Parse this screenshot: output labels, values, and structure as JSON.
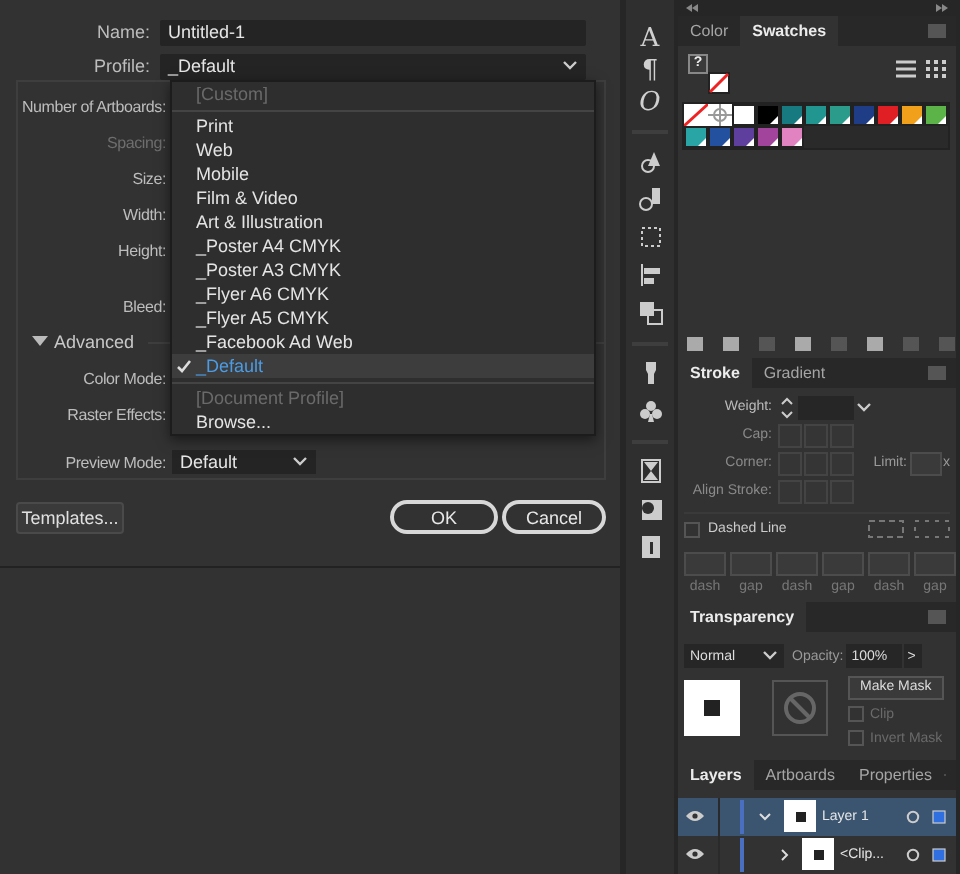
{
  "dialog": {
    "fields": [
      {
        "label": "Name:",
        "value": "Untitled-1"
      },
      {
        "label": "Profile:",
        "value": "_Default"
      }
    ],
    "settings": [
      {
        "label": "Number of Artboards:",
        "disabled": false
      },
      {
        "label": "Spacing:",
        "disabled": true
      },
      {
        "label": "Size:",
        "disabled": false
      },
      {
        "label": "Width:",
        "disabled": false
      },
      {
        "label": "Height:",
        "disabled": false
      },
      {
        "label": "Bleed:",
        "disabled": false
      }
    ],
    "advanced": {
      "label": "Advanced",
      "expanded": true
    },
    "advanced_settings": [
      {
        "label": "Color Mode:"
      },
      {
        "label": "Raster Effects:"
      },
      {
        "label": "Preview Mode:",
        "value": "Default"
      }
    ],
    "buttons": {
      "templates": "Templates...",
      "ok": "OK",
      "cancel": "Cancel"
    }
  },
  "profile_menu": {
    "items": [
      {
        "kind": "item",
        "label": "[Custom]",
        "disabled": true,
        "selected": false
      },
      {
        "kind": "separator"
      },
      {
        "kind": "item",
        "label": "Print",
        "disabled": false,
        "selected": false
      },
      {
        "kind": "item",
        "label": "Web",
        "disabled": false,
        "selected": false
      },
      {
        "kind": "item",
        "label": "Mobile",
        "disabled": false,
        "selected": false
      },
      {
        "kind": "item",
        "label": "Film & Video",
        "disabled": false,
        "selected": false
      },
      {
        "kind": "item",
        "label": "Art & Illustration",
        "disabled": false,
        "selected": false
      },
      {
        "kind": "item",
        "label": "_Poster A4 CMYK",
        "disabled": false,
        "selected": false
      },
      {
        "kind": "item",
        "label": "_Poster A3 CMYK",
        "disabled": false,
        "selected": false
      },
      {
        "kind": "item",
        "label": "_Flyer A6 CMYK",
        "disabled": false,
        "selected": false
      },
      {
        "kind": "item",
        "label": "_Flyer A5 CMYK",
        "disabled": false,
        "selected": false
      },
      {
        "kind": "item",
        "label": "_Facebook Ad Web",
        "disabled": false,
        "selected": false
      },
      {
        "kind": "item",
        "label": "_Default",
        "disabled": false,
        "selected": true
      },
      {
        "kind": "separator"
      },
      {
        "kind": "item",
        "label": "[Document Profile]",
        "disabled": true,
        "selected": false
      },
      {
        "kind": "item",
        "label": "Browse...",
        "disabled": false,
        "selected": false
      }
    ]
  },
  "tools": {
    "glyphs": [
      "A",
      "¶",
      "O"
    ]
  },
  "swatches_panel": {
    "tabs": [
      {
        "label": "Color",
        "selected": false
      },
      {
        "label": "Swatches",
        "selected": true
      }
    ],
    "fill_indicator": "?",
    "swatches": [
      {
        "kind": "none"
      },
      {
        "kind": "registration"
      },
      {
        "kind": "color",
        "color": "#ffffff"
      },
      {
        "kind": "color",
        "color": "#000000"
      },
      {
        "kind": "color",
        "color": "#167a80"
      },
      {
        "kind": "color",
        "color": "#21958f"
      },
      {
        "kind": "color",
        "color": "#2b9c8c"
      },
      {
        "kind": "color",
        "color": "#1f3c86"
      },
      {
        "kind": "color",
        "color": "#e01f25"
      },
      {
        "kind": "color",
        "color": "#f0a01a"
      },
      {
        "kind": "color",
        "color": "#5cb448"
      },
      {
        "kind": "color",
        "color": "#2aa5a6"
      },
      {
        "kind": "color",
        "color": "#2450a0"
      },
      {
        "kind": "color",
        "color": "#5e3f9e"
      },
      {
        "kind": "color",
        "color": "#a2449c"
      },
      {
        "kind": "color",
        "color": "#e083c0"
      }
    ]
  },
  "stroke_panel": {
    "tabs": [
      {
        "label": "Stroke",
        "selected": true
      },
      {
        "label": "Gradient",
        "selected": false
      }
    ],
    "weight": "Weight:",
    "cap": "Cap:",
    "corner": "Corner:",
    "limit": "Limit:",
    "limit_unit": "x",
    "align": "Align Stroke:",
    "dashed_line": {
      "label": "Dashed Line",
      "checked": false
    },
    "dash_fields": [
      "dash",
      "gap",
      "dash",
      "gap",
      "dash",
      "gap"
    ]
  },
  "transparency_panel": {
    "title": "Transparency",
    "blend_mode": "Normal",
    "opacity_label": "Opacity:",
    "opacity": "100%",
    "opacity_button": ">",
    "make_mask": "Make Mask",
    "options": [
      {
        "label": "Clip",
        "checked": false
      },
      {
        "label": "Invert Mask",
        "checked": false
      }
    ]
  },
  "layers_panel": {
    "tabs": [
      {
        "label": "Layers",
        "selected": true
      },
      {
        "label": "Artboards",
        "selected": false
      },
      {
        "label": "Properties",
        "selected": false
      }
    ],
    "layers": [
      {
        "name": "Layer 1",
        "expanded": true,
        "selected": true,
        "children": [
          {
            "name": "<Clip...",
            "expanded": false,
            "selected": false
          }
        ]
      }
    ]
  }
}
